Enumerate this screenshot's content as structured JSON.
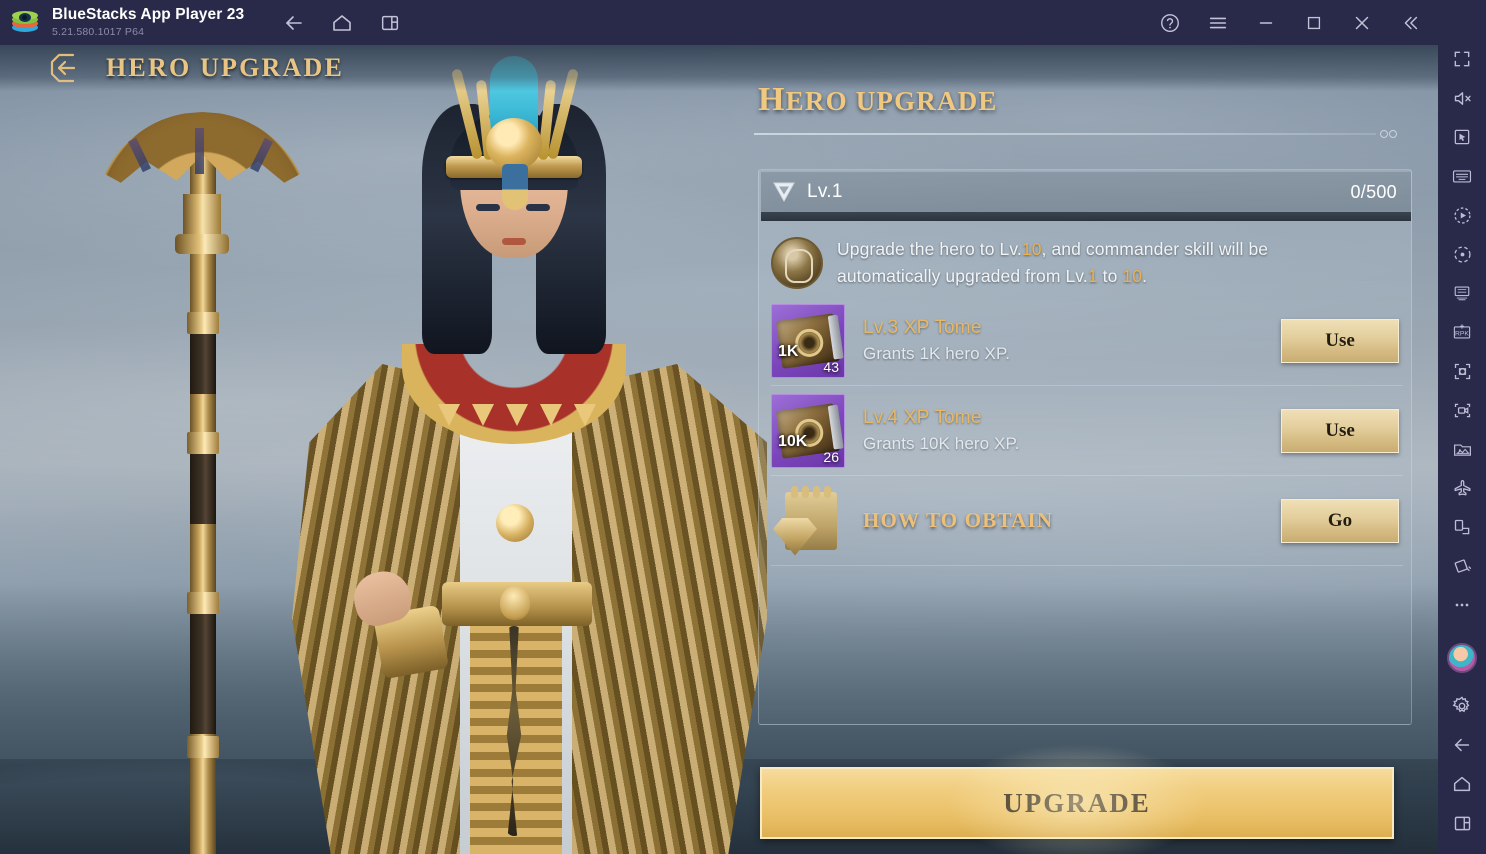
{
  "titlebar": {
    "app_name": "BlueStacks App Player 23",
    "version": "5.21.580.1017  P64",
    "logo_icon": "bluestacks-logo",
    "nav": [
      {
        "name": "back-icon",
        "label": "Back"
      },
      {
        "name": "home-icon",
        "label": "Home"
      },
      {
        "name": "multi-instance-icon",
        "label": "Multi-instance"
      }
    ],
    "window_controls": [
      {
        "name": "help-icon",
        "label": "Help"
      },
      {
        "name": "menu-icon",
        "label": "Menu"
      },
      {
        "name": "minimize-icon",
        "label": "Minimize"
      },
      {
        "name": "maximize-icon",
        "label": "Maximize"
      },
      {
        "name": "close-icon",
        "label": "Close"
      },
      {
        "name": "collapse-sidebar-icon",
        "label": "Collapse"
      }
    ]
  },
  "sidebar": {
    "items": [
      {
        "name": "fullscreen-icon",
        "label": "Fullscreen"
      },
      {
        "name": "mute-icon",
        "label": "Mute"
      },
      {
        "name": "cursor-icon",
        "label": "Game controls"
      },
      {
        "name": "keyboard-icon",
        "label": "Keymapping"
      },
      {
        "name": "macro-play-icon",
        "label": "Macro recorder"
      },
      {
        "name": "eco-mode-icon",
        "label": "Eco mode"
      },
      {
        "name": "multi-instance-manager-icon",
        "label": "Multi-instance manager"
      },
      {
        "name": "rpk-install-icon",
        "label": "Install APK"
      },
      {
        "name": "screenshot-icon",
        "label": "Screenshot"
      },
      {
        "name": "video-record-icon",
        "label": "Record screen"
      },
      {
        "name": "media-manager-icon",
        "label": "Media manager"
      },
      {
        "name": "airplane-icon",
        "label": "Shake"
      },
      {
        "name": "rotate-screen-icon",
        "label": "Rotate"
      },
      {
        "name": "tilt-icon",
        "label": "Tilt"
      },
      {
        "name": "more-icon",
        "label": "More"
      }
    ],
    "bottom": [
      {
        "name": "avatar",
        "label": "Profile"
      },
      {
        "name": "gear-icon",
        "label": "Settings"
      },
      {
        "name": "back-icon",
        "label": "Back"
      },
      {
        "name": "home-icon",
        "label": "Home"
      },
      {
        "name": "recents-icon",
        "label": "Recents"
      }
    ]
  },
  "game": {
    "header": {
      "back_icon": "back-arrow-icon",
      "title": "HERO UPGRADE"
    },
    "panel": {
      "title_first": "H",
      "title_rest": "ERO UPGRADE",
      "level": {
        "icon": "gem-icon",
        "label": "Lv.1",
        "progress": "0/500",
        "current": 0,
        "max": 500
      },
      "tip": {
        "icon": "commander-medal-icon",
        "line1_a": "Upgrade the hero to Lv.",
        "line1_b": "10",
        "line1_c": ", and commander skill will be",
        "line2_a": "automatically upgraded from Lv.",
        "line2_b": "1",
        "line2_c": " to ",
        "line2_d": "10",
        "line2_e": "."
      },
      "items": [
        {
          "icon": "xp-tome-icon",
          "amount": "1K",
          "count": "43",
          "name": "Lv.3 XP Tome",
          "desc": "Grants 1K hero XP.",
          "button": "Use"
        },
        {
          "icon": "xp-tome-icon",
          "amount": "10K",
          "count": "26",
          "name": "Lv.4 XP Tome",
          "desc": "Grants 10K hero XP.",
          "button": "Use"
        }
      ],
      "obtain": {
        "icon": "how-to-obtain-icon",
        "label": "HOW TO OBTAIN",
        "button": "Go"
      },
      "upgrade_button": "UPGRADE"
    }
  },
  "colors": {
    "titlebar_bg": "#29294a",
    "gold_text": "#e9c583",
    "gold_accent": "#edb14a",
    "item_name": "#e7b763",
    "button_gold": "#e2cd9a",
    "upgrade_gold": "#edc570",
    "tome_purple": "#7b46bb"
  }
}
